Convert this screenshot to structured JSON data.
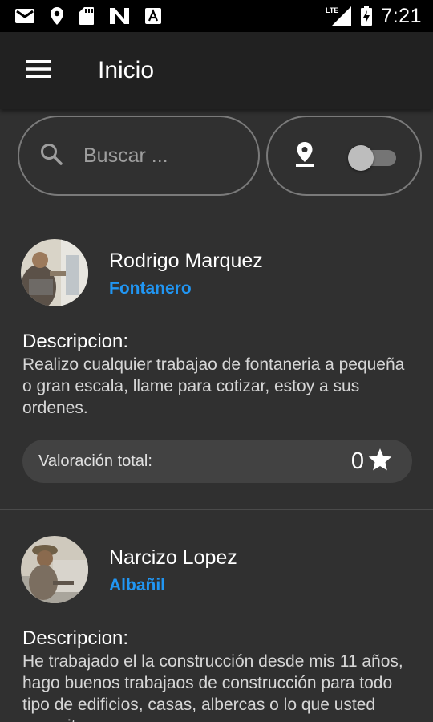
{
  "status_bar": {
    "network": "LTE",
    "time": "7:21",
    "icons": [
      "gmail-icon",
      "location-pin-icon",
      "sd-card-icon",
      "n-app-icon",
      "a-app-icon",
      "signal-icon",
      "battery-charging-icon"
    ]
  },
  "app_bar": {
    "title": "Inicio",
    "menu_icon": "hamburger-menu-icon"
  },
  "filters": {
    "search_placeholder": "Buscar ...",
    "search_icon": "search-icon",
    "location_icon": "location-pin-icon",
    "location_toggle_on": false
  },
  "colors": {
    "accent": "#2196f3",
    "background": "#303030",
    "app_bar": "#212121",
    "rating_pill": "#424242"
  },
  "workers": [
    {
      "name": "Rodrigo Marquez",
      "profession": "Fontanero",
      "description_label": "Descripcion:",
      "description": "Realizo cualquier trabajao de fontaneria a pequeña o gran escala, llame para cotizar, estoy a sus ordenes.",
      "rating_label": "Valoración total:",
      "rating_value": "0",
      "rating_icon": "star-icon"
    },
    {
      "name": "Narcizo Lopez",
      "profession": "Albañil",
      "description_label": "Descripcion:",
      "description": "He trabajado el la construcción desde mis 11 años, hago buenos trabajaos de construcción para todo tipo de edificios, casas, albercas o lo que usted necesite."
    }
  ]
}
